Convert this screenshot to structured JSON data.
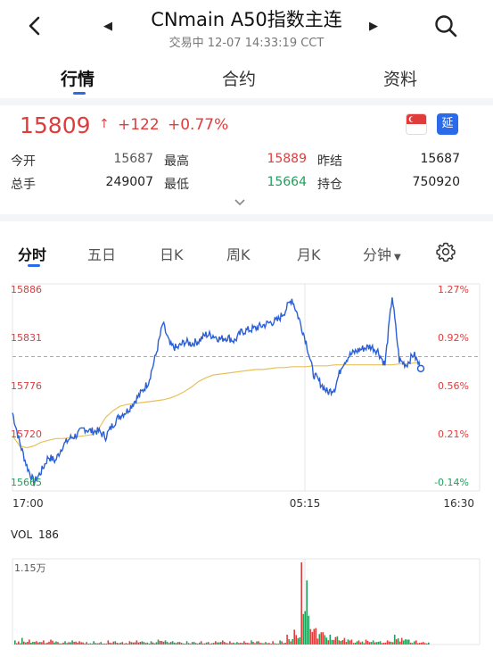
{
  "header": {
    "title": "CNmain A50指数主连",
    "subtitle": "交易中 12-07 14:33:19 CCT",
    "back_icon": "chevron-left-icon",
    "search_icon": "search-icon"
  },
  "main_tabs": [
    {
      "label": "行情",
      "active": true
    },
    {
      "label": "合约",
      "active": false
    },
    {
      "label": "资料",
      "active": false
    }
  ],
  "quote": {
    "price": "15809",
    "arrow": "↑",
    "change": "+122",
    "change_pct": "+0.77%",
    "delay_badge": "延",
    "stats": [
      {
        "label": "今开",
        "value": "15687",
        "color": "#555555"
      },
      {
        "label": "最高",
        "value": "15889",
        "color": "#e03c3c"
      },
      {
        "label": "昨结",
        "value": "15687",
        "color": "#222222"
      },
      {
        "label": "总手",
        "value": "249007",
        "color": "#222222"
      },
      {
        "label": "最低",
        "value": "15664",
        "color": "#20a05a"
      },
      {
        "label": "持仓",
        "value": "750920",
        "color": "#222222"
      }
    ]
  },
  "chart_tabs": [
    {
      "label": "分时",
      "active": true
    },
    {
      "label": "五日",
      "active": false
    },
    {
      "label": "日K",
      "active": false
    },
    {
      "label": "周K",
      "active": false
    },
    {
      "label": "月K",
      "active": false
    },
    {
      "label": "分钟",
      "active": false,
      "dropdown": true
    }
  ],
  "colors": {
    "up": "#e03c3c",
    "down": "#20a05a",
    "line": "#2b5fd6",
    "avg": "#e8c15a",
    "accent": "#2b6ae8"
  },
  "chart_data": {
    "type": "line",
    "y_left_ticks": [
      "15886",
      "15831",
      "15776",
      "15720",
      "15665"
    ],
    "y_right_ticks": [
      "1.27%",
      "0.92%",
      "0.56%",
      "0.21%",
      "-0.14%"
    ],
    "x_ticks": [
      "17:00",
      "05:15",
      "16:30"
    ],
    "ylim": [
      15665,
      15886
    ],
    "prev_settle": 15809,
    "series": [
      {
        "values": [
          15748,
          15716,
          15690,
          15672,
          15684,
          15700,
          15696,
          15712,
          15720,
          15724,
          15731,
          15728,
          15728,
          15722,
          15735,
          15745,
          15750,
          15760,
          15770,
          15782,
          15810,
          15845,
          15821,
          15818,
          15825,
          15823,
          15826,
          15833,
          15832,
          15828,
          15830,
          15826,
          15836,
          15838,
          15840,
          15843,
          15846,
          15848,
          15858,
          15872,
          15850,
          15825,
          15790,
          15780,
          15770,
          15775,
          15800,
          15810,
          15815,
          15818,
          15820,
          15815,
          15800,
          15875,
          15805,
          15800,
          15812,
          15796
        ]
      },
      {
        "values": [
          15723,
          15712,
          15710,
          15712,
          15716,
          15718,
          15720,
          15720,
          15721,
          15722,
          15723,
          15724,
          15730,
          15743,
          15750,
          15755,
          15757,
          15758,
          15759,
          15760,
          15761,
          15762,
          15764,
          15767,
          15771,
          15776,
          15782,
          15786,
          15789,
          15790,
          15791,
          15792,
          15793,
          15794,
          15795,
          15795,
          15796,
          15797,
          15797,
          15798,
          15798,
          15798,
          15799,
          15799,
          15799,
          15800,
          15800,
          15800,
          15800,
          15800,
          15800,
          15800,
          15800,
          15800,
          15801,
          15801,
          15802,
          15802
        ]
      }
    ],
    "volume": {
      "label": "VOL",
      "value": "186",
      "axis_max": "1.15万",
      "bars": [
        0.05,
        0.08,
        0.06,
        0.04,
        0.05,
        0.06,
        0.03,
        0.04,
        0.05,
        0.04,
        0.03,
        0.04,
        0.03,
        0.05,
        0.04,
        0.03,
        0.04,
        0.05,
        0.03,
        0.04,
        0.06,
        0.05,
        0.04,
        0.03,
        0.04,
        0.03,
        0.04,
        0.03,
        0.04,
        0.05,
        0.04,
        0.03,
        0.04,
        0.05,
        0.04,
        0.03,
        0.04,
        0.05,
        0.12,
        0.18,
        1.0,
        0.35,
        0.2,
        0.15,
        0.12,
        0.1,
        0.08,
        0.06,
        0.05,
        0.06,
        0.05,
        0.04,
        0.05,
        0.12,
        0.08,
        0.06,
        0.05,
        0.03
      ]
    }
  }
}
